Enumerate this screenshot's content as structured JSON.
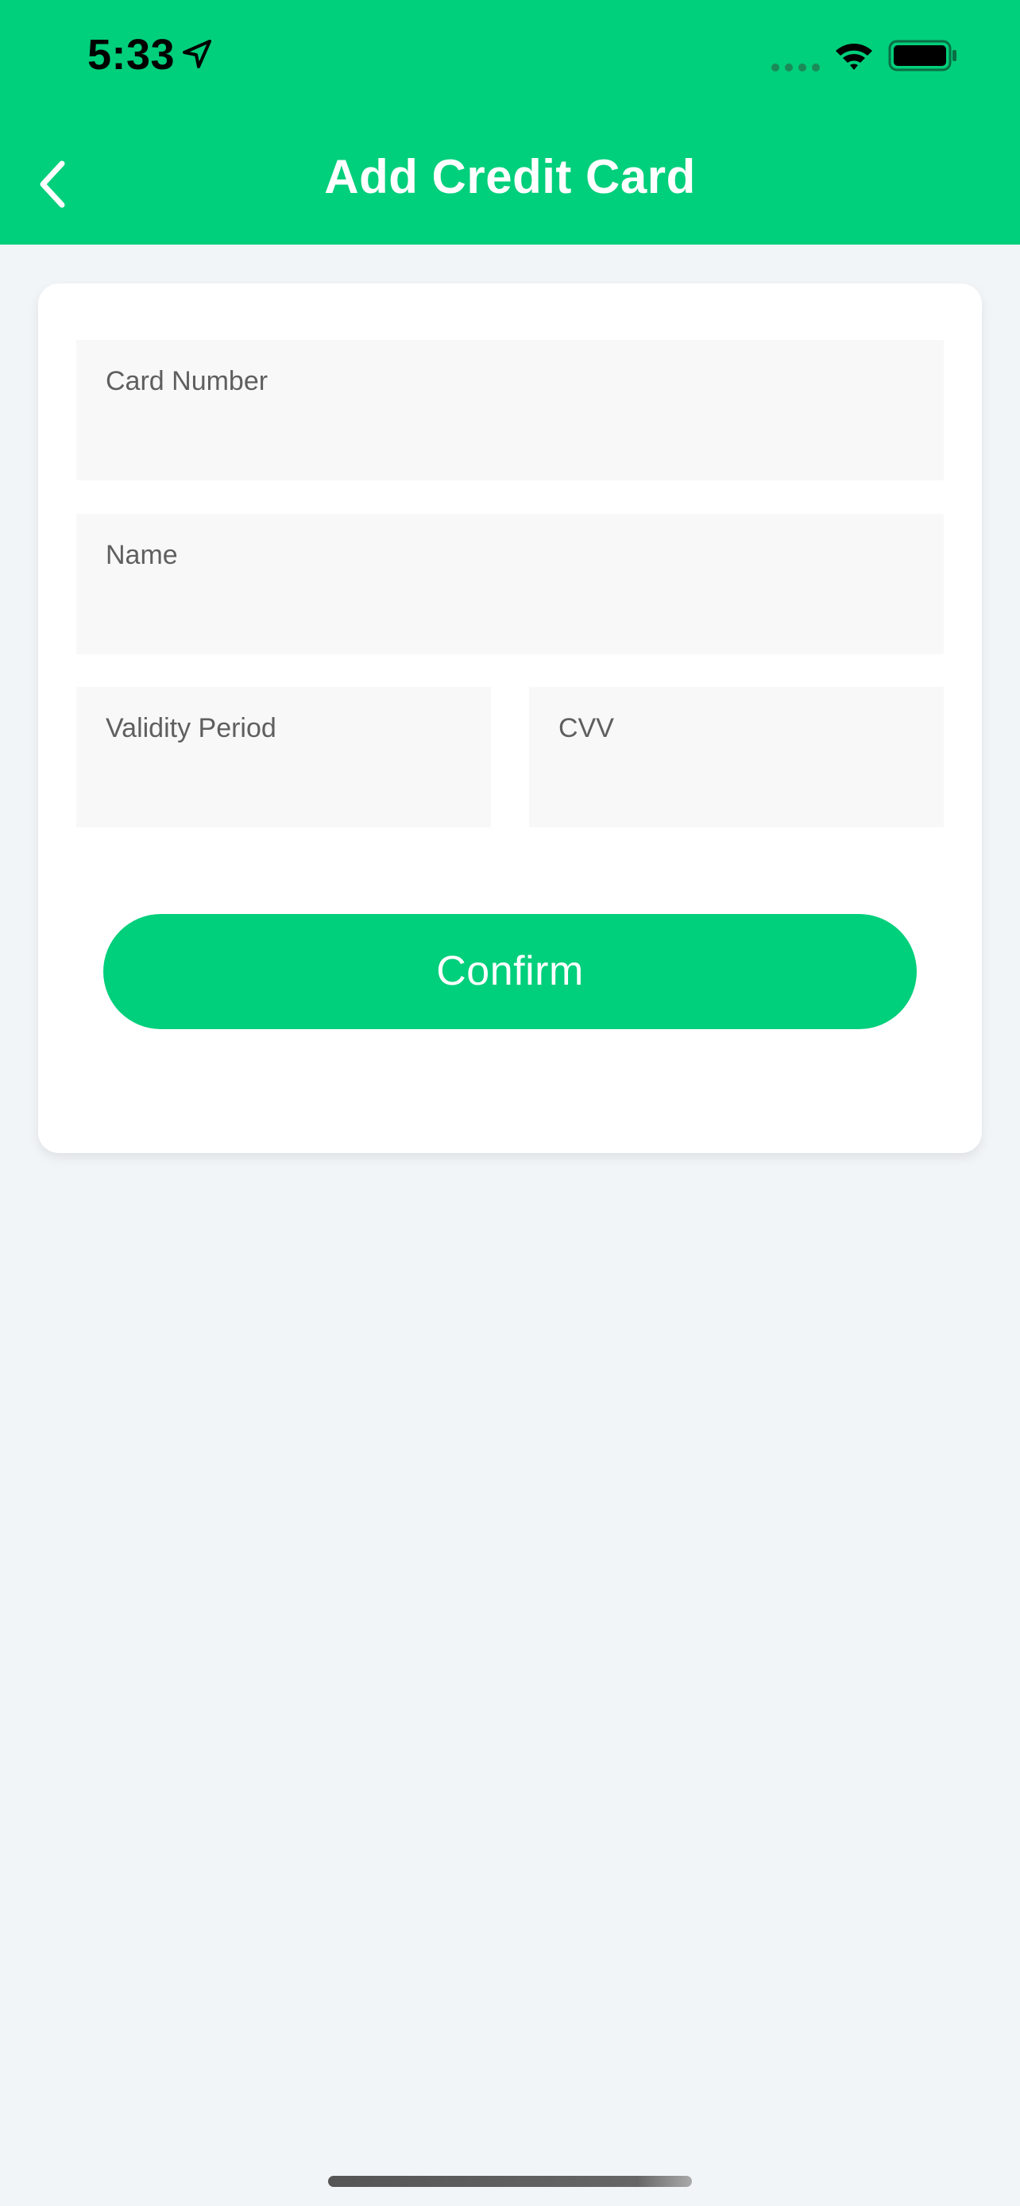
{
  "status_bar": {
    "time": "5:33",
    "icons": [
      "location-arrow-icon",
      "cellular-signal-icon",
      "wifi-icon",
      "battery-icon"
    ]
  },
  "header": {
    "title": "Add Credit Card",
    "back_icon": "chevron-left-icon"
  },
  "form": {
    "card_number_label": "Card Number",
    "name_label": "Name",
    "validity_label": "Validity Period",
    "cvv_label": "CVV",
    "confirm_label": "Confirm"
  },
  "colors": {
    "accent": "#00cf7b",
    "background": "#f2f5f8",
    "field_background": "#f8f8f8",
    "card_background": "#ffffff",
    "label_text": "#5f5f5f"
  }
}
